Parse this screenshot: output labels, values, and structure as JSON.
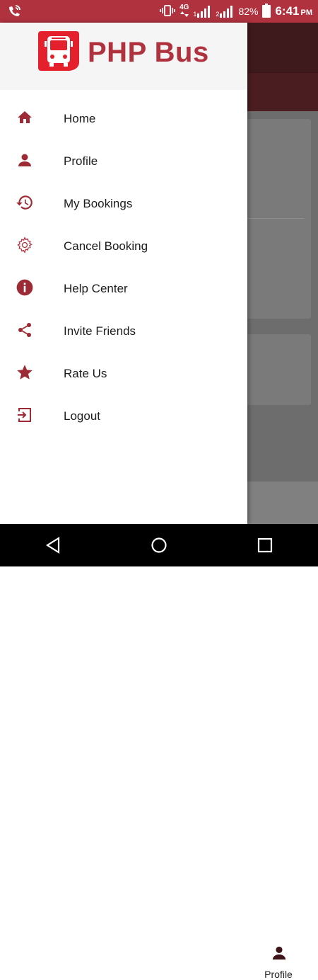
{
  "status_bar": {
    "network_type": "4G",
    "sim1": "1",
    "sim2": "2",
    "battery": "82%",
    "time": "6:41",
    "ampm": "PM"
  },
  "drawer": {
    "brand": "PHP Bus",
    "items": [
      {
        "label": "Home",
        "icon": "home-icon"
      },
      {
        "label": "Profile",
        "icon": "person-icon"
      },
      {
        "label": "My Bookings",
        "icon": "history-icon"
      },
      {
        "label": "Cancel Booking",
        "icon": "gear-icon"
      },
      {
        "label": "Help Center",
        "icon": "info-icon"
      },
      {
        "label": "Invite Friends",
        "icon": "share-icon"
      },
      {
        "label": "Rate Us",
        "icon": "star-icon"
      },
      {
        "label": "Logout",
        "icon": "logout-icon"
      }
    ]
  },
  "background_app": {
    "bottom_tab_label": "Profile"
  },
  "colors": {
    "accent": "#b0323f",
    "icon": "#9c2b35"
  }
}
